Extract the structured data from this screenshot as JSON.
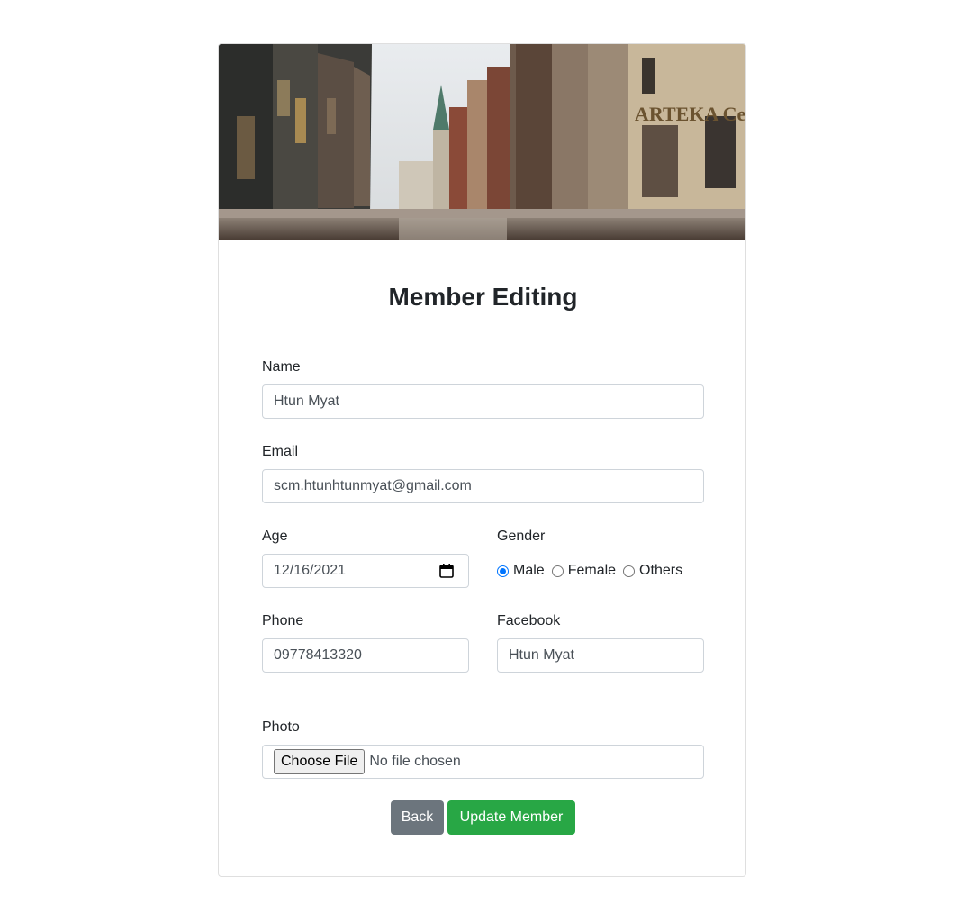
{
  "form": {
    "title": "Member Editing",
    "name": {
      "label": "Name",
      "value": "Htun Myat"
    },
    "email": {
      "label": "Email",
      "value": "scm.htunhtunmyat@gmail.com"
    },
    "age": {
      "label": "Age",
      "value": "12/16/2021"
    },
    "gender": {
      "label": "Gender",
      "options": [
        "Male",
        "Female",
        "Others"
      ],
      "selected": "Male"
    },
    "phone": {
      "label": "Phone",
      "value": "09778413320"
    },
    "facebook": {
      "label": "Facebook",
      "value": "Htun Myat"
    },
    "photo": {
      "label": "Photo",
      "button": "Choose File",
      "status": "No file chosen"
    },
    "buttons": {
      "back": "Back",
      "update": "Update Member"
    }
  },
  "colors": {
    "back_button": "#6c757d",
    "update_button": "#28a745",
    "radio_accent": "#0075ff"
  }
}
